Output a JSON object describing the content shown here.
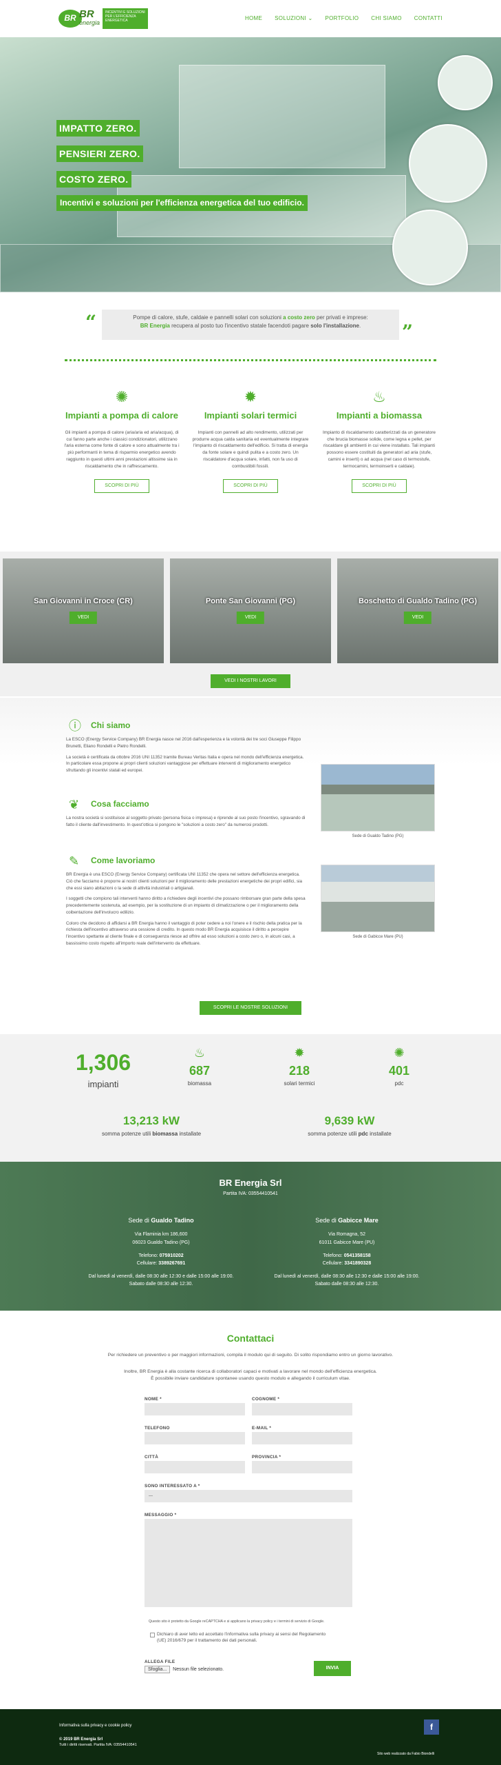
{
  "brand": {
    "logo_mark": "BR",
    "logo_word": "BR",
    "logo_sub": "energia",
    "tagline": "INCENTIVI E SOLUZIONI PER L'EFFICIENZA ENERGETICA"
  },
  "nav": {
    "items": [
      "HOME",
      "SOLUZIONI ⌄",
      "PORTFOLIO",
      "CHI SIAMO",
      "CONTATTI"
    ]
  },
  "hero": {
    "lines": [
      "IMPATTO ZERO.",
      "PENSIERI ZERO.",
      "COSTO ZERO."
    ],
    "subtitle": "Incentivi e soluzioni per l'efficienza energetica del tuo edificio."
  },
  "quote": {
    "part1": "Pompe di calore, stufe, caldaie e pannelli solari con soluzioni ",
    "hl1": "a costo zero",
    "part2": " per privati e imprese:",
    "hl2": "BR Energia",
    "part3": " recupera al posto tuo l'incentivo statale facendoti pagare ",
    "hl3": "solo l'installazione",
    "part4": "."
  },
  "services": [
    {
      "title": "Impianti a pompa di calore",
      "text": "Gli impianti a pompa di calore (aria/aria ed aria/acqua), di cui fanno parte anche i classici condizionatori, utilizzano l'aria esterna come fonte di calore e sono attualmente tra i più performanti in tema di risparmio energetico avendo raggiunto in questi ultimi anni prestazioni altissime sia in riscaldamento che in raffrescamento.",
      "button": "SCOPRI DI PIÙ"
    },
    {
      "title": "Impianti solari termici",
      "text": "Impianti con pannelli ad alto rendimento, utilizzati per produrre acqua calda sanitaria ed eventualmente integrare l'impianto di riscaldamento dell'edificio. Si tratta di energia da fonte solare e quindi pulita e a costo zero. Un riscaldatore d'acqua solare, infatti, non fa uso di combustibili fossili.",
      "button": "SCOPRI DI PIÙ"
    },
    {
      "title": "Impianti a biomassa",
      "text": "Impianto di riscaldamento caratterizzati da un generatore che brucia biomasse solide, come legna e pellet, per riscaldare gli ambienti in cui viene installato. Tali impianti possono essere costituiti da generatori ad aria (stufe, camini e inserti) o ad acqua (nel caso di termostufe, termocamini, termoinserti e caldaie).",
      "button": "SCOPRI DI PIÙ"
    }
  ],
  "projects": [
    {
      "title": "San Giovanni in Croce (CR)",
      "button": "VEDI"
    },
    {
      "title": "Ponte San Giovanni (PG)",
      "button": "VEDI"
    },
    {
      "title": "Boschetto di Gualdo Tadino (PG)",
      "button": "VEDI"
    }
  ],
  "projects_button": "VEDI I NOSTRI LAVORI",
  "about": {
    "chi_title": "Chi siamo",
    "chi_p1": "La ESCO (Energy Service Company) BR Energia nasce nel 2016 dall'esperienza e la volontà dei tre soci Giuseppe Filippo Brunetti, Eliano Rondelli e Pietro Rondelli.",
    "chi_p2": "La società è certificata da ottobre 2016 UNI 11352 tramite Bureau Veritas Italia e opera nel mondo dell'efficienza energetica. In particolare essa propone ai propri clienti soluzioni vantaggiose per effettuare interventi di miglioramento energetico sfruttando gli incentivi statali ed europei.",
    "cosa_title": "Cosa facciamo",
    "cosa_p": "La nostra società si sostituisce al soggetto privato (persona fisica o impresa) e riprende al suo posto l'incentivo, sgravando di fatto il cliente dall'investimento. In quest'ottica si pongono le \"soluzioni a costo zero\" da numerosi prodotti.",
    "come_title": "Come lavoriamo",
    "come_p1": "BR Energia è una ESCO (Energy Service Company) certificata UNI 11352 che opera nel settore dell'efficienza energetica. Ciò che facciamo è proporre ai nostri clienti soluzioni per il miglioramento delle prestazioni energetiche dei propri edifici, sia che essi siano abitazioni o la sede di attività industriali o artigianali.",
    "come_p2": "I soggetti che compiono tali interventi hanno diritto a richiedere degli incentivi che possano rimborsare gran parte della spesa precedentemente sostenuta, ad esempio, per la sostituzione di un impianto di climatizzazione o per il miglioramento della coibentazione dell'involucro edilizio.",
    "come_p3": "Coloro che decidono di affidarsi a BR Energia hanno il vantaggio di poter cedere a noi l'onere e il rischio della pratica per la richiesta dell'incentivo attraverso una cessione di credito. In questo modo BR Energia acquisisce il diritto a percepire l'incentivo spettante al cliente finale e di conseguenza riesce ad offrire ad esso soluzioni a costo zero o, in alcuni casi, a bassissimo costo rispetto all'importo reale dell'intervento da effettuare.",
    "photo1_caption": "Sede di Gualdo Tadino (PG)",
    "photo2_caption": "Sede di Gabicce Mare (PU)",
    "button": "SCOPRI LE NOSTRE SOLUZIONI"
  },
  "stats": {
    "total": "1,306",
    "total_label": "impianti",
    "biomassa": "687",
    "biomassa_label": "biomassa",
    "solari": "218",
    "solari_label": "solari termici",
    "pdc": "401",
    "pdc_label": "pdc",
    "kw1": "13,213 kW",
    "kw1_label_a": "somma potenze utili ",
    "kw1_label_b": "biomassa",
    "kw1_label_c": " installate",
    "kw2": "9,639 kW",
    "kw2_label_a": "somma potenze utili ",
    "kw2_label_b": "pdc",
    "kw2_label_c": " installate"
  },
  "company": {
    "name": "BR Energia Srl",
    "piva": "Partita IVA: 03554410541",
    "office1": {
      "title_a": "Sede di ",
      "title_b": "Gualdo Tadino",
      "addr1": "Via Flaminia km 186,600",
      "addr2": "06023 Gualdo Tadino (PG)",
      "tel_l": "Telefono: ",
      "tel": "075910202",
      "cel_l": "Cellulare: ",
      "cel": "3389267691",
      "hours": "Dal lunedì al venerdì, dalle 08:30 alle 12:30 e dalle 15:00 alle 19:00.",
      "sat": "Sabato dalle 08:30 alle 12:30."
    },
    "office2": {
      "title_a": "Sede di ",
      "title_b": "Gabicce Mare",
      "addr1": "Via Romagna, 52",
      "addr2": "61011 Gabicce Mare (PU)",
      "tel_l": "Telefono: ",
      "tel": "0541358158",
      "cel_l": "Cellulare: ",
      "cel": "3341890328",
      "hours": "Dal lunedì al venerdì, dalle 08:30 alle 12:30 e dalle 15:00 alle 19:00.",
      "sat": "Sabato dalle 08:30 alle 12:30."
    }
  },
  "contact": {
    "title": "Contattaci",
    "intro1": "Per richiedere un preventivo o per maggiori informazioni, compila il modulo qui di seguito. Di solito rispondiamo entro un giorno lavorativo.",
    "intro2": "Inoltre, BR Energia è alla costante ricerca di collaboratori capaci e motivati a lavorare nel mondo dell'efficienza energetica.",
    "intro3": "È possibile inviare candidature spontanee usando questo modulo e allegando il curriculum vitae.",
    "nome": "NOME *",
    "cognome": "COGNOME *",
    "telefono": "TELEFONO",
    "email": "E-MAIL *",
    "citta": "CITTÀ",
    "provincia": "PROVINCIA *",
    "interesse": "SONO INTERESSATO A *",
    "interesse_value": "---",
    "messaggio": "MESSAGGIO *",
    "recaptcha": "Questo sito è protetto da Google reCAPTCHA e si applicano la privacy policy e i termini di servizio di Google.",
    "privacy": "Dichiaro di aver letto ed accettato l'informativa sulla privacy ai sensi del Regolamento (UE) 2016/679 per il trattamento dei dati personali.",
    "allega": "ALLEGA FILE",
    "sfoglia": "Sfoglia...",
    "nessun": "Nessun file selezionato.",
    "invia": "INVIA"
  },
  "footer": {
    "policy": "Informativa sulla privacy e cookie policy",
    "copy": "© 2019 BR Energia Srl",
    "rights": "Tutti i diritti riservati. Partita IVA: 03554410541",
    "credit": "Sito web realizzato da Fabio Biondelli"
  },
  "colors": {
    "accent": "#4fae2c",
    "footer": "#0e2a10"
  }
}
